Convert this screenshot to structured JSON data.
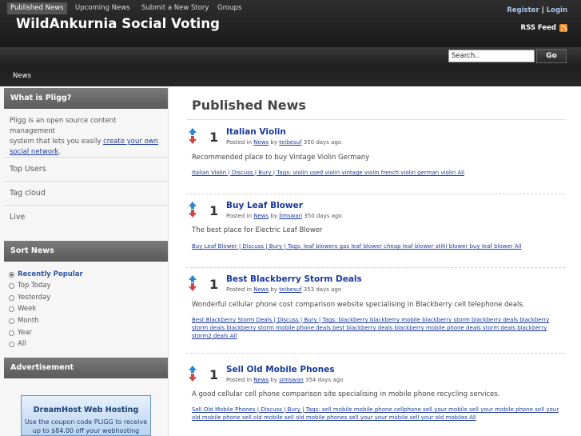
{
  "site": {
    "title": "WildAnkurnia Social Voting"
  },
  "top_links": {
    "register": "Register",
    "sep": "|",
    "login": "Login"
  },
  "rss": {
    "label": "RSS Feed",
    "icon": "rss-icon",
    "color": "#f08a24"
  },
  "nav": {
    "items": [
      "Published News",
      "Upcoming News",
      "Submit a New Story",
      "Groups"
    ],
    "active": "Published News"
  },
  "search": {
    "value": "Search..",
    "button": "Go"
  },
  "subnav": {
    "item": "News"
  },
  "sidebar": {
    "what_head": "What is Pligg?",
    "what_text_1": "Pligg is an open source content management",
    "what_text_2_pre": "system that lets you easily ",
    "what_link_1": "create your own",
    "what_link_2": "social network",
    "what_end": ".",
    "links": [
      "Top Users",
      "Tag cloud",
      "Live"
    ],
    "sort_head": "Sort News",
    "sort_options": [
      "Recently Popular",
      "Top Today",
      "Yesterday",
      "Week",
      "Month",
      "Year",
      "All"
    ],
    "sort_selected": "Recently Popular",
    "ad_head": "Advertisement",
    "ad": {
      "title": "DreamHost Web Hosting",
      "line1": "Use the coupon code PLIGG to receive",
      "line2": "up to $84.00 off your webhosting"
    }
  },
  "main": {
    "title": "Published News",
    "stories": [
      {
        "votes": "1",
        "title": "Italian Violin",
        "posted_pre": "Posted in",
        "category": "News",
        "by": "by",
        "user": "teibesuf",
        "age": "350 days ago",
        "desc": "Recommended place to buy Vintage Violin Germany",
        "tags_html": "Italian Violin | Discuss | Bury | Tags: violin used violin vintage violin french violin german violin All"
      },
      {
        "votes": "1",
        "title": "Buy Leaf Blower",
        "posted_pre": "Posted in",
        "category": "News",
        "by": "by",
        "user": "limswan",
        "age": "350 days ago",
        "desc": "The best place for Electric Leaf Blower",
        "tags_html": "Buy Leaf Blower | Discuss | Bury | Tags: leaf blowers gas leaf blower cheap leaf blower stihl blower buy leaf blower All"
      },
      {
        "votes": "1",
        "title": "Best Blackberry Storm Deals",
        "posted_pre": "Posted in",
        "category": "News",
        "by": "by",
        "user": "teibesuf",
        "age": "353 days ago",
        "desc": "Wonderful cellular phone cost comparison website specialising in Blackberry cell telephone deals.",
        "tags_html": "Best Blackberry Storm Deals | Discuss | Bury | Tags: blackberry blackberry mobile blackberry storm blackberry deals blackberry storm deals blackberry storm mobile phone deals best blackberry deals blackberry mobile phone deals storm deals blackberry storm2 deals All"
      },
      {
        "votes": "1",
        "title": "Sell Old Mobile Phones",
        "posted_pre": "Posted in",
        "category": "News",
        "by": "by",
        "user": "simswan",
        "age": "354 days ago",
        "desc": "A good cellular cell phone comparison site specialising in mobile phone recycling services.",
        "tags_html": "Sell Old Mobile Phones | Discuss | Bury | Tags: sell mobile mobile phone cellphone sell your mobile sell your mobile phone sell your old mobile phone sell old mobile sell old mobile phones sell your your mobile sell your old mobiles All"
      }
    ]
  }
}
